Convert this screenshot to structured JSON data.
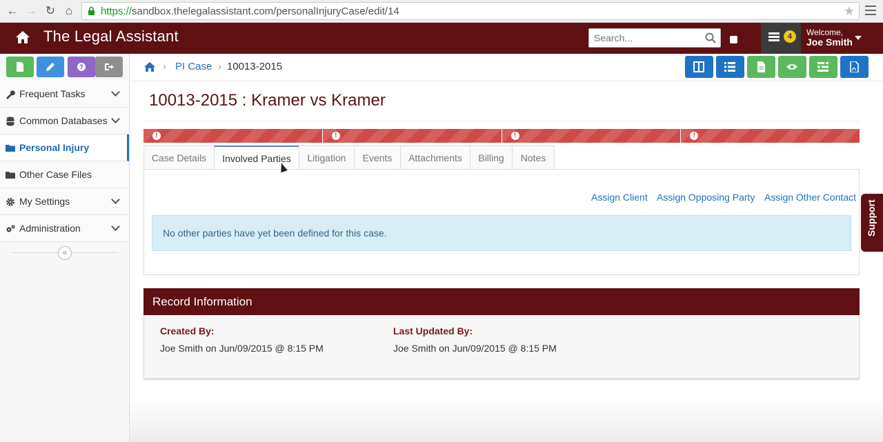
{
  "browser": {
    "url_scheme": "https://",
    "url_rest": "sandbox.thelegalassistant.com/personalInjuryCase/edit/14"
  },
  "header": {
    "brand": "The Legal Assistant",
    "search_placeholder": "Search...",
    "notification_count": "4",
    "welcome": "Welcome,",
    "user_name": "Joe Smith"
  },
  "sidebar": {
    "items": [
      {
        "label": "Frequent Tasks"
      },
      {
        "label": "Common Databases"
      },
      {
        "label": "Personal Injury"
      },
      {
        "label": "Other Case Files"
      },
      {
        "label": "My Settings"
      },
      {
        "label": "Administration"
      }
    ],
    "collapse_glyph": "«"
  },
  "breadcrumb": {
    "section": "PI Case",
    "current": "10013-2015"
  },
  "case": {
    "title": "10013-2015 : Kramer vs Kramer"
  },
  "tabs": [
    {
      "label": "Case Details"
    },
    {
      "label": "Involved Parties"
    },
    {
      "label": "Litigation"
    },
    {
      "label": "Events"
    },
    {
      "label": "Attachments"
    },
    {
      "label": "Billing"
    },
    {
      "label": "Notes"
    }
  ],
  "involved_parties": {
    "assign_client": "Assign Client",
    "assign_opposing": "Assign Opposing Party",
    "assign_other": "Assign Other Contact",
    "empty_message": "No other parties have yet been defined for this case."
  },
  "record": {
    "heading": "Record Information",
    "created_label": "Created By:",
    "created_value": "Joe Smith on Jun/09/2015 @ 8:15 PM",
    "updated_label": "Last Updated By:",
    "updated_value": "Joe Smith on Jun/09/2015 @ 8:15 PM"
  },
  "support": "Support",
  "colors": {
    "brand": "#5e1012",
    "progress": "#cf4a47",
    "link": "#2670b8",
    "toolbar_blue": "#1f73c4",
    "toolbar_green": "#5cb85c"
  }
}
